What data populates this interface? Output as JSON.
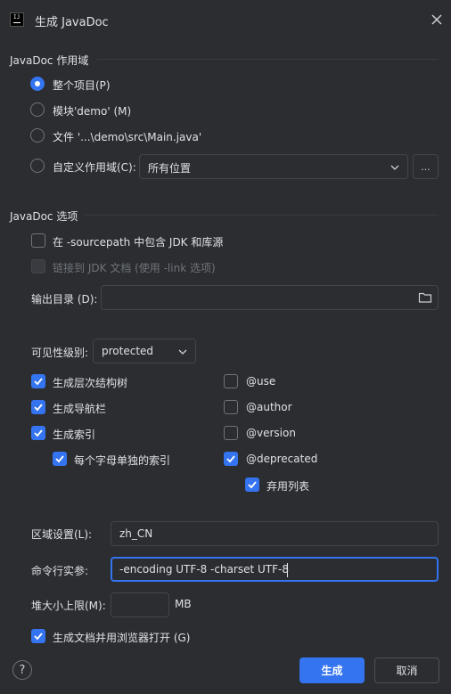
{
  "window": {
    "logo_text": "IJ",
    "title": "生成 JavaDoc"
  },
  "scope": {
    "heading": "JavaDoc 作用域",
    "options": [
      {
        "label": "整个项目(P)",
        "checked": true
      },
      {
        "label": "模块'demo' (M)",
        "checked": false
      },
      {
        "label": "文件 '...\\demo\\src\\Main.java'",
        "checked": false
      },
      {
        "label": "自定义作用域(C):",
        "checked": false
      }
    ],
    "custom_scope_value": "所有位置",
    "custom_scope_more": "..."
  },
  "options": {
    "heading": "JavaDoc 选项",
    "include_jdk": {
      "label": "在 -sourcepath 中包含 JDK 和库源",
      "checked": false
    },
    "link_jdk": {
      "label": "链接到 JDK 文档 (使用 -link 选项)",
      "checked": false,
      "disabled": true
    },
    "output_dir_label": "输出目录 (D):",
    "output_dir_value": ""
  },
  "visibility": {
    "label": "可见性级别:",
    "value": "protected"
  },
  "left_checks": [
    {
      "label": "生成层次结构树",
      "checked": true
    },
    {
      "label": "生成导航栏",
      "checked": true
    },
    {
      "label": "生成索引",
      "checked": true
    },
    {
      "label": "每个字母单独的索引",
      "checked": true
    }
  ],
  "right_checks": [
    {
      "label": "@use",
      "checked": false
    },
    {
      "label": "@author",
      "checked": false
    },
    {
      "label": "@version",
      "checked": false
    },
    {
      "label": "@deprecated",
      "checked": true
    },
    {
      "label": "弃用列表",
      "checked": true
    }
  ],
  "locale": {
    "label": "区域设置(L):",
    "value": "zh_CN"
  },
  "cmdline": {
    "label": "命令行实参:",
    "value": "-encoding UTF-8 -charset UTF-8"
  },
  "heap": {
    "label": "堆大小上限(M):",
    "value": "",
    "unit": "MB"
  },
  "open_browser": {
    "label": "生成文档并用浏览器打开 (G)",
    "checked": true
  },
  "footer": {
    "help": "?",
    "ok": "生成",
    "cancel": "取消"
  },
  "colors": {
    "accent": "#3574f0",
    "background": "#2b2d30",
    "border": "#43454a"
  }
}
